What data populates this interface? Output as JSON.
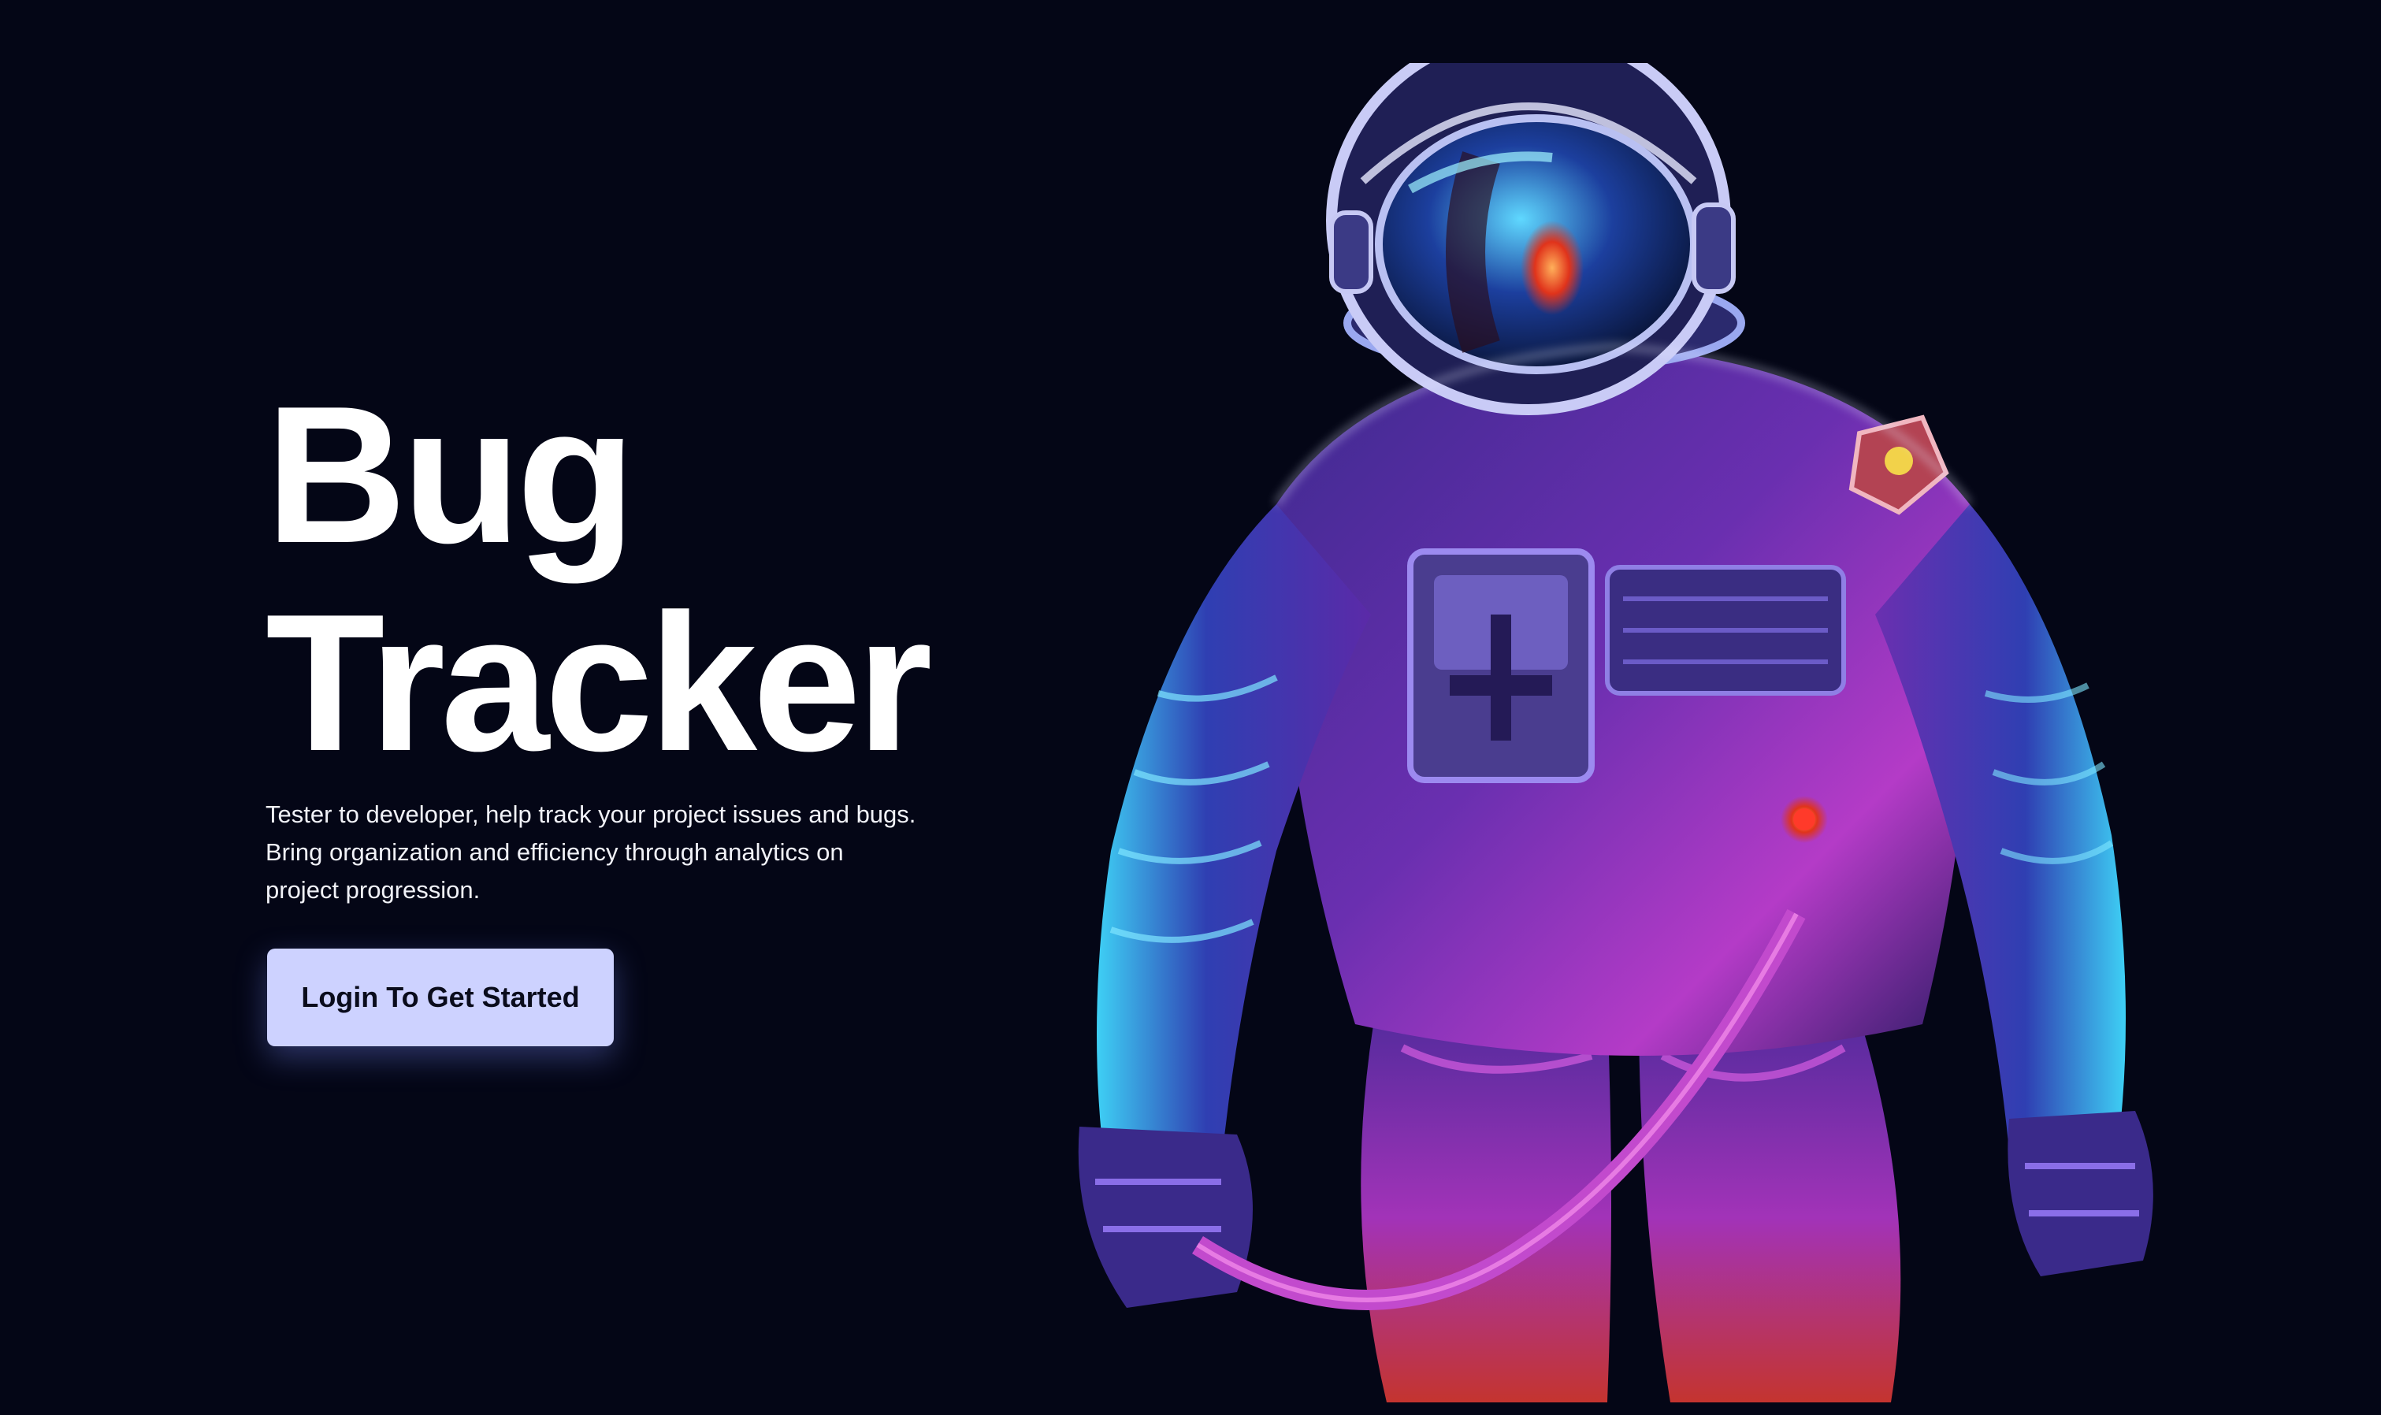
{
  "hero": {
    "title_line1": "Bug",
    "title_line2": "Tracker",
    "description_line1": "Tester to developer, help track your project issues and bugs.",
    "description_line2": "Bring organization and efficiency through analytics on",
    "description_line3": "project progression.",
    "cta_label": "Login To Get Started"
  },
  "illustration": {
    "icon": "astronaut-illustration"
  },
  "colors": {
    "background": "#040616",
    "title": "#ffffff",
    "button_bg": "#cdd2ff",
    "button_text": "#0a0c1c",
    "accent_magenta": "#c23bd4",
    "accent_cyan": "#35c8f0"
  }
}
